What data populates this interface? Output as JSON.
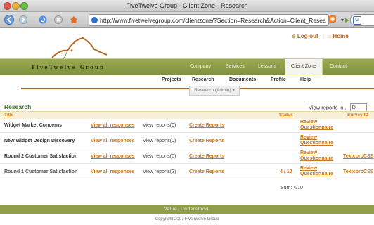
{
  "window": {
    "title": "FiveTwelve Group - Client Zone - Research"
  },
  "browser": {
    "url": "http://www.fivetwelvegroup.com/clientzone/?Section=Research&Action=Client_Resea",
    "search_icon_label": "G"
  },
  "header": {
    "logout_label": "Log-out",
    "home_label": "Home"
  },
  "nav": {
    "brand": "FiveTwelve Group",
    "items": [
      "Company",
      "Services",
      "Lessons",
      "Client Zone",
      "Contact"
    ]
  },
  "subnav": {
    "items": [
      "Projects",
      "Research",
      "Documents",
      "Profile",
      "Help"
    ],
    "dropdown": "Research (Admin)"
  },
  "content": {
    "title": "Research",
    "view_reports_label": "View reports in...",
    "view_reports_value": "D",
    "columns": {
      "title": "Title",
      "status": "Status",
      "survey": "Survey ID"
    },
    "rows": [
      {
        "title": "Widget Market Concerns",
        "responses": "View all responses",
        "reports": "View reports(0)",
        "create": "Create Reports",
        "status": "",
        "review": "Review Questionnaire",
        "survey": ""
      },
      {
        "title": "New Widget Design Discovery",
        "responses": "View all responses",
        "reports": "View reports(0)",
        "create": "Create Reports",
        "status": "",
        "review": "Review Questionnaire",
        "survey": ""
      },
      {
        "title": "Round 2 Customer Satisfaction",
        "responses": "View all responses",
        "reports": "View reports(0)",
        "create": "Create Reports",
        "status": "",
        "review": "Review Questionnaire",
        "survey": "TextcorpCSS"
      },
      {
        "title": "Round 1 Customer Satisfaction",
        "responses": "View all responses",
        "reports": "View reports(2)",
        "create": "Create Reports",
        "status": "4 / 10",
        "review": "Review Questionnaire",
        "survey": "TextcorpCSS"
      }
    ],
    "sum": "Sum: 4/10"
  },
  "footer": {
    "tagline": "Value. Understood.",
    "copyright": "Copyright 2007 FiveTwelve Group"
  }
}
